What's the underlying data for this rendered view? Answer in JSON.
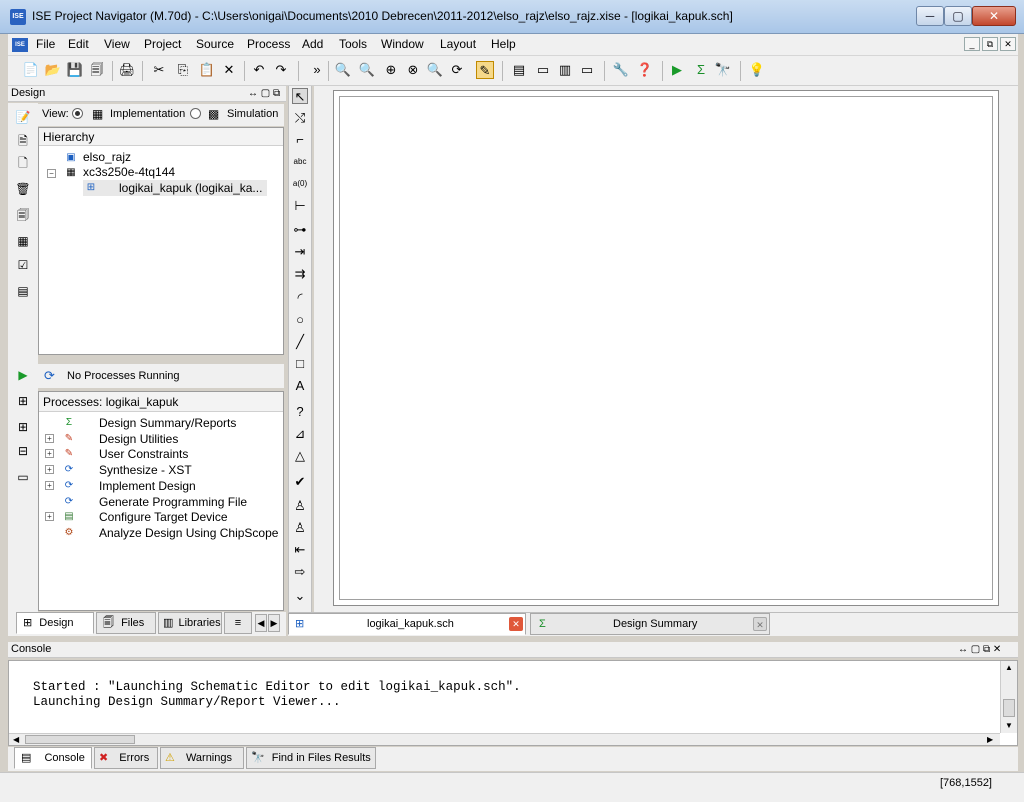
{
  "window": {
    "title": "ISE Project Navigator (M.70d) - C:\\Users\\onigai\\Documents\\2010 Debrecen\\2011-2012\\elso_rajz\\elso_rajz.xise - [logikai_kapuk.sch]",
    "app_icon": "ISE",
    "min": "─",
    "max": "▢",
    "close": "✕"
  },
  "menu": {
    "items": [
      "File",
      "Edit",
      "View",
      "Project",
      "Source",
      "Process",
      "Add",
      "Tools",
      "Window",
      "Layout",
      "Help"
    ],
    "mdi": [
      "_",
      "⧉",
      "✕"
    ]
  },
  "toolbar": {
    "icons": [
      "📄",
      "📂",
      "💾",
      "🗐",
      "🖨",
      "✂",
      "⎘",
      "📋",
      "✕",
      "↶",
      "↷",
      "»",
      "🔍",
      "🔍",
      "⊕",
      "⊗",
      "🔍",
      "⟳",
      "✎",
      "▤",
      "▭",
      "▥",
      "▭",
      "🔧",
      "❓",
      "▶",
      "Σ",
      "🔭",
      "💡"
    ]
  },
  "design_panel": {
    "title": "Design",
    "view_label": "View:",
    "implementation_label": "Implementation",
    "simulation_label": "Simulation",
    "hierarchy_header": "Hierarchy",
    "hierarchy": [
      {
        "label": "elso_rajz",
        "icon": "▣"
      },
      {
        "label": "xc3s250e-4tq144",
        "icon": "▦"
      },
      {
        "label": "logikai_kapuk (logikai_ka...",
        "icon": "⊞"
      }
    ],
    "no_processes": "No Processes Running",
    "processes_header": "Processes: logikai_kapuk",
    "processes": [
      {
        "label": "Design Summary/Reports",
        "icon": "Σ",
        "color": "#1a8f2a",
        "expand": false
      },
      {
        "label": "Design Utilities",
        "icon": "✎",
        "color": "#c23b1e",
        "expand": true
      },
      {
        "label": "User Constraints",
        "icon": "✎",
        "color": "#c23b1e",
        "expand": true
      },
      {
        "label": "Synthesize - XST",
        "icon": "⟳",
        "color": "#1b5fc1",
        "expand": true
      },
      {
        "label": "Implement Design",
        "icon": "⟳",
        "color": "#1b5fc1",
        "expand": true
      },
      {
        "label": "Generate Programming File",
        "icon": "⟳",
        "color": "#1b5fc1",
        "expand": false
      },
      {
        "label": "Configure Target Device",
        "icon": "▤",
        "color": "#3a7d3a",
        "expand": true
      },
      {
        "label": "Analyze Design Using ChipScope",
        "icon": "⚙",
        "color": "#b14a1a",
        "expand": false
      }
    ],
    "tabs": [
      {
        "label": "Design",
        "icon": "⊞",
        "active": true
      },
      {
        "label": "Files",
        "icon": "🗐",
        "active": false
      },
      {
        "label": "Libraries",
        "icon": "▥",
        "active": false
      },
      {
        "label": "",
        "icon": "≡",
        "active": false
      }
    ]
  },
  "editor": {
    "tabs": [
      {
        "label": "logikai_kapuk.sch",
        "icon": "⊞",
        "active": true
      },
      {
        "label": "Design Summary",
        "icon": "Σ",
        "active": false
      }
    ]
  },
  "schematic_tools": [
    "↖",
    "⤭",
    "⌐",
    "abc",
    "a(0)",
    "⊢",
    "⊶",
    "⇥",
    "⇉",
    "◜",
    "○",
    "╱",
    "□",
    "A",
    "?",
    "⊿",
    "△",
    "✔",
    "♙",
    "♙",
    "⇤",
    "⇨",
    "⌄"
  ],
  "console": {
    "title": "Console",
    "lines": [
      "Started : \"Launching Schematic Editor to edit logikai_kapuk.sch\".",
      "Launching Design Summary/Report Viewer..."
    ],
    "tabs": [
      {
        "label": "Console",
        "icon": "▤",
        "active": true
      },
      {
        "label": "Errors",
        "icon": "✖",
        "active": false
      },
      {
        "label": "Warnings",
        "icon": "⚠",
        "active": false
      },
      {
        "label": "Find in Files Results",
        "icon": "🔭",
        "active": false
      }
    ]
  },
  "status": {
    "coords": "[768,1552]"
  }
}
